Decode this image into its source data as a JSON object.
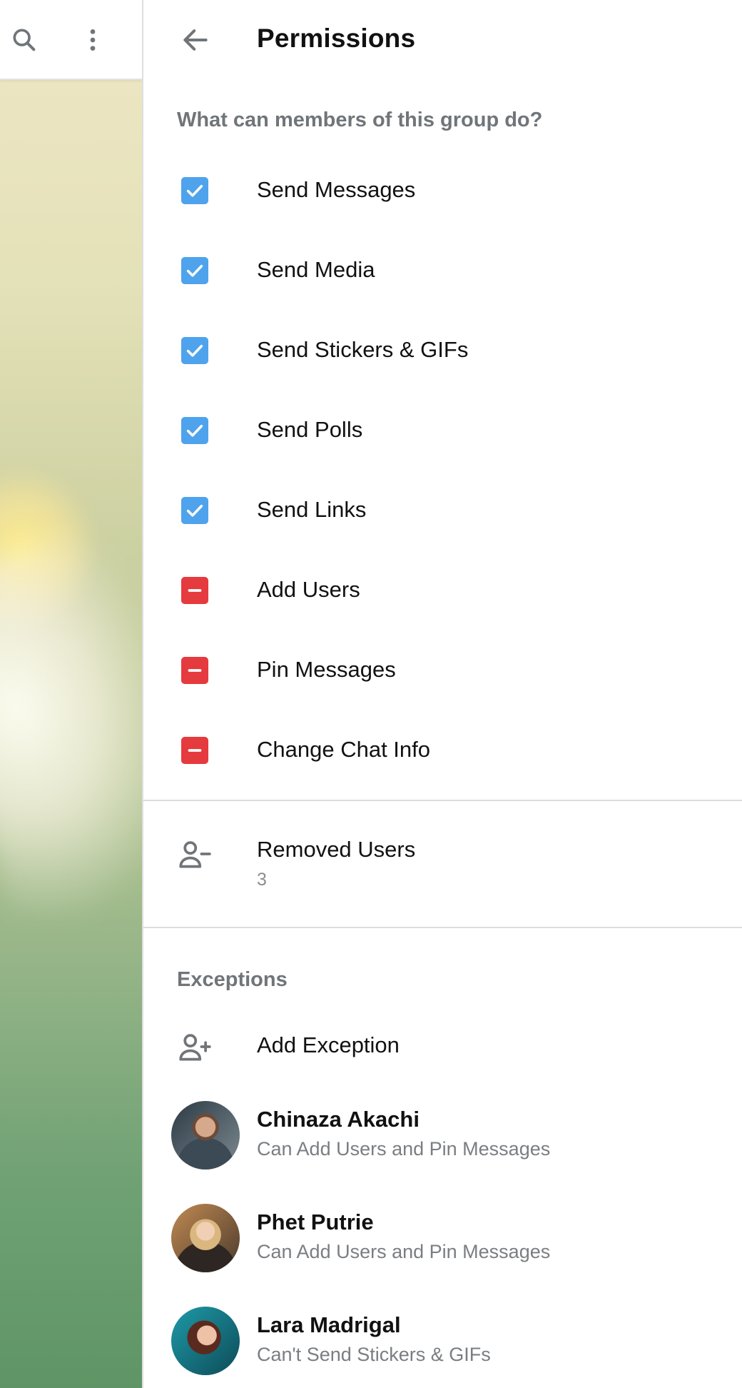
{
  "header": {
    "title": "Permissions"
  },
  "permissions": {
    "section_label": "What can members of this group do?",
    "items": [
      {
        "label": "Send Messages",
        "state": "allowed"
      },
      {
        "label": "Send Media",
        "state": "allowed"
      },
      {
        "label": "Send Stickers & GIFs",
        "state": "allowed"
      },
      {
        "label": "Send Polls",
        "state": "allowed"
      },
      {
        "label": "Send Links",
        "state": "allowed"
      },
      {
        "label": "Add Users",
        "state": "denied"
      },
      {
        "label": "Pin Messages",
        "state": "denied"
      },
      {
        "label": "Change Chat Info",
        "state": "denied"
      }
    ]
  },
  "removed_users": {
    "label": "Removed Users",
    "count": "3"
  },
  "exceptions": {
    "section_label": "Exceptions",
    "add_label": "Add Exception",
    "items": [
      {
        "name": "Chinaza Akachi",
        "desc": "Can Add Users and Pin Messages"
      },
      {
        "name": "Phet Putrie",
        "desc": "Can Add Users and Pin Messages"
      },
      {
        "name": "Lara Madrigal",
        "desc": "Can't Send Stickers & GIFs"
      }
    ]
  },
  "colors": {
    "accent": "#4fa3ec",
    "danger": "#e53a3e",
    "secondary_text": "#707579"
  },
  "icons": {
    "search": "search-icon",
    "more": "more-vertical-icon",
    "back": "arrow-left-icon",
    "check": "checkmark-icon",
    "minus": "minus-icon",
    "remove_user": "person-remove-icon",
    "add_user": "person-add-icon",
    "confirm": "checkmark-icon"
  }
}
